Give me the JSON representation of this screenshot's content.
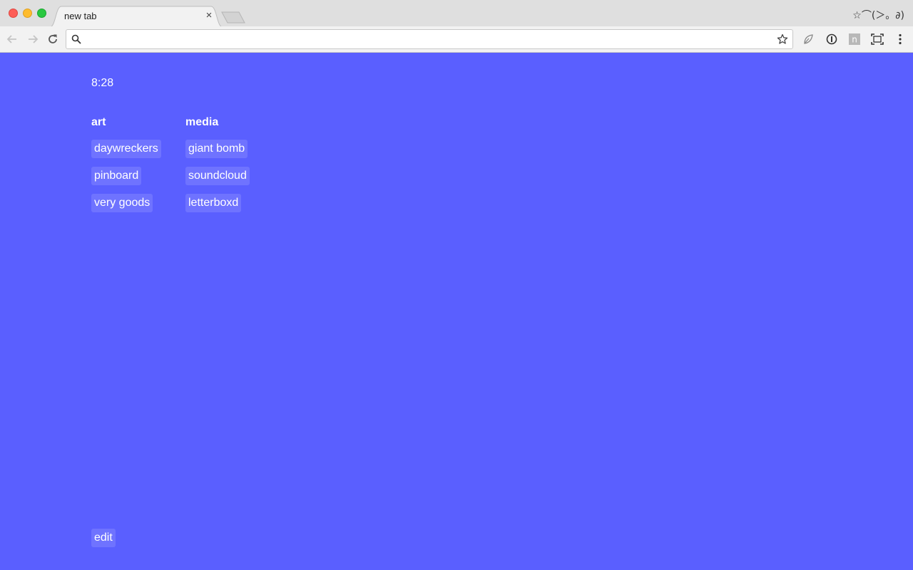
{
  "browser": {
    "tab_title": "new tab",
    "tab_close": "×",
    "profile_label": "☆⌒(＞。∂)",
    "omnibox_value": "",
    "omnibox_placeholder": ""
  },
  "page": {
    "background": "#5a5fff",
    "clock": "8:28",
    "groups": [
      {
        "heading": "art",
        "links": [
          "daywreckers",
          "pinboard",
          "very goods"
        ]
      },
      {
        "heading": "media",
        "links": [
          "giant bomb",
          "soundcloud",
          "letterboxd"
        ]
      }
    ],
    "edit_label": "edit"
  }
}
